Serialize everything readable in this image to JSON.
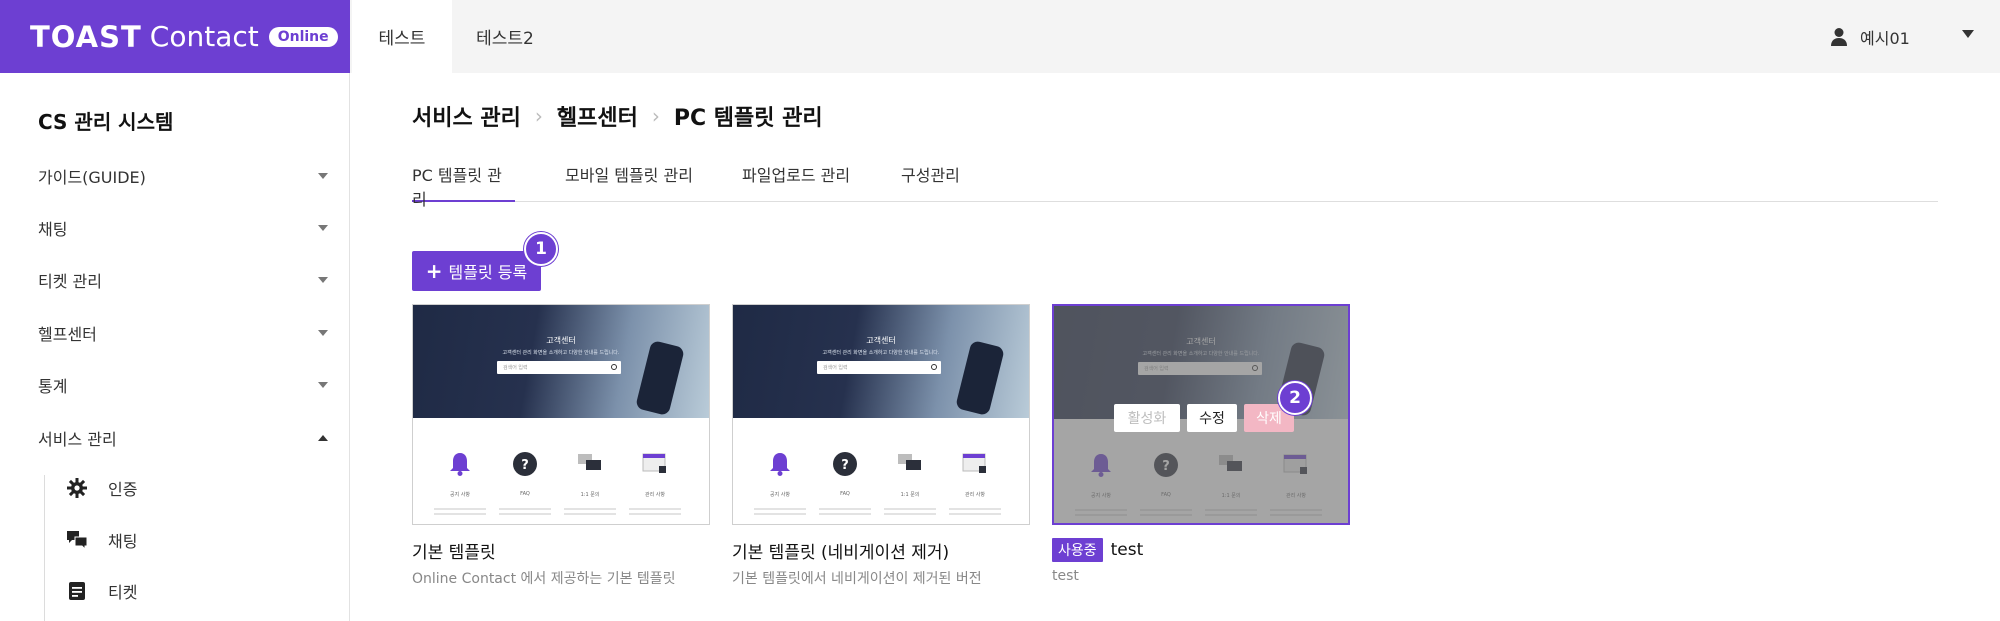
{
  "brand": {
    "toast": "TOAST",
    "contact": "Contact",
    "online": "Online",
    "color": "#6d3fd2"
  },
  "top_tabs": [
    {
      "label": "테스트",
      "active": true
    },
    {
      "label": "테스트2",
      "active": false
    }
  ],
  "user": {
    "name": "예시01",
    "icon": "user-icon"
  },
  "sidebar": {
    "title": "CS 관리 시스템",
    "items": [
      {
        "label": "가이드(GUIDE)",
        "expanded": false
      },
      {
        "label": "채팅",
        "expanded": false
      },
      {
        "label": "티켓 관리",
        "expanded": false
      },
      {
        "label": "헬프센터",
        "expanded": false
      },
      {
        "label": "통계",
        "expanded": false
      },
      {
        "label": "서비스 관리",
        "expanded": true
      }
    ],
    "sub_items": [
      {
        "label": "인증",
        "icon": "gear-icon"
      },
      {
        "label": "채팅",
        "icon": "chat-icon"
      },
      {
        "label": "티켓",
        "icon": "document-icon"
      }
    ]
  },
  "breadcrumb": [
    "서비스 관리",
    "헬프센터",
    "PC 템플릿 관리"
  ],
  "subtabs": [
    {
      "label": "PC 템플릿 관리",
      "active": true
    },
    {
      "label": "모바일 템플릿 관리",
      "active": false
    },
    {
      "label": "파일업로드 관리",
      "active": false
    },
    {
      "label": "구성관리",
      "active": false
    }
  ],
  "add_button": {
    "label": "템플릿 등록",
    "step": "1"
  },
  "thumbnail": {
    "hero_title": "고객센터",
    "hero_sub": "고객센터 관리 화면을 소개하고 다양한 안내를 드립니다.",
    "search_placeholder": "검색어 입력",
    "labels": [
      "공지 사항",
      "FAQ",
      "1:1 문의",
      "관리 사항"
    ]
  },
  "templates": [
    {
      "name": "기본 템플릿",
      "description": "Online Contact 에서 제공하는 기본 템플릿",
      "in_use": false
    },
    {
      "name": "기본 템플릿 (네비게이션 제거)",
      "description": "기본 템플릿에서 네비게이션이 제거된 버전",
      "in_use": false
    },
    {
      "name": "test",
      "description": "test",
      "in_use": true,
      "in_use_label": "사용중"
    }
  ],
  "overlay": {
    "activate": "활성화",
    "edit": "수정",
    "delete": "삭제",
    "step": "2"
  }
}
